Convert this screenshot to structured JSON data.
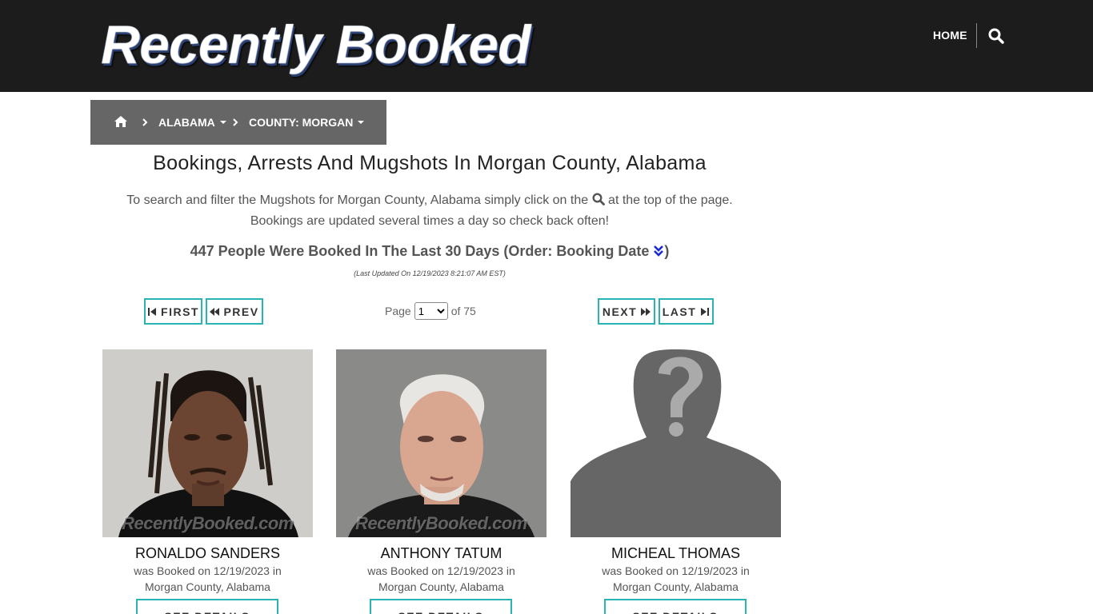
{
  "header": {
    "logo_text": "Recently Booked",
    "nav_home": "HOME"
  },
  "breadcrumb": {
    "state": "ALABAMA",
    "county": "COUNTY: MORGAN"
  },
  "page": {
    "title": "Bookings, Arrests And Mugshots In Morgan County, Alabama",
    "intro_line1_a": "To search and filter the Mugshots for Morgan County, Alabama simply click on the",
    "intro_line1_b": "at the top of the page.",
    "intro_line2": "Bookings are updated several times a day so check back often!",
    "count_text": "447 People Were Booked In The Last 30 Days (Order: Booking Date",
    "count_close": ")",
    "last_updated": "(Last Updated On 12/19/2023 8:21:07 AM EST)"
  },
  "pager": {
    "first": "FIRST",
    "prev": "PREV",
    "next": "NEXT",
    "last": "LAST",
    "page_label": "Page",
    "current_page": "1",
    "of_label": "of 75"
  },
  "cards": [
    {
      "name": "RONALDO SANDERS",
      "booked": "was Booked on 12/19/2023 in",
      "county": "Morgan County, Alabama",
      "watermark": "RecentlyBooked.com",
      "details": "SEE DETAILS"
    },
    {
      "name": "ANTHONY TATUM",
      "booked": "was Booked on 12/19/2023 in",
      "county": "Morgan County, Alabama",
      "watermark": "RecentlyBooked.com",
      "details": "SEE DETAILS"
    },
    {
      "name": "MICHEAL THOMAS",
      "booked": "was Booked on 12/19/2023 in",
      "county": "Morgan County, Alabama",
      "details": "SEE DETAILS"
    }
  ],
  "colors": {
    "header_bg": "#1c1c1c",
    "breadcrumb_bg": "#666666",
    "accent_border": "#2ab3b3",
    "sort_icon": "#1a2bd6"
  },
  "icons": {
    "search": "search-icon",
    "home": "home-icon",
    "sort": "double-chevron-down-icon"
  }
}
